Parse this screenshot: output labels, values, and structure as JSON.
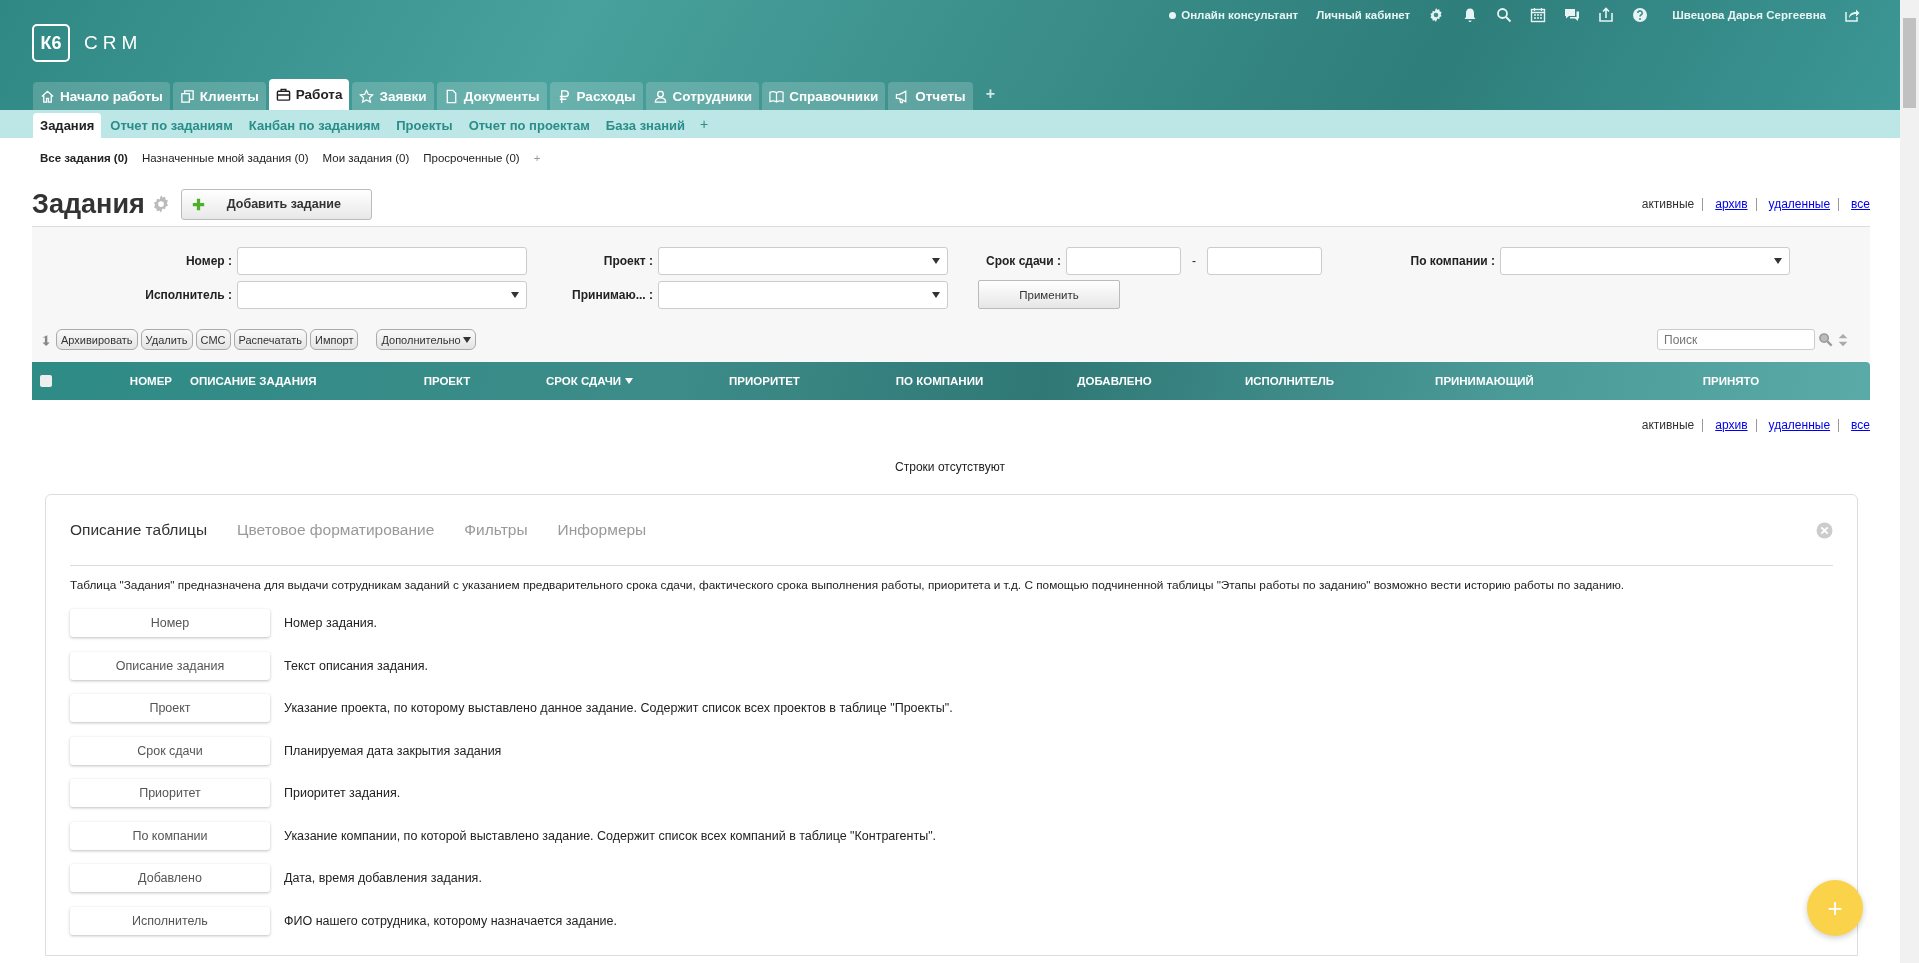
{
  "logo": {
    "mark": "К6",
    "text": "CRM"
  },
  "top_nav": {
    "online_consultant": "Онлайн консультант",
    "cabinet": "Личный кабинет",
    "user": "Швецова Дарья Сергеевна"
  },
  "main_tabs": [
    {
      "label": "Начало работы",
      "selected": false
    },
    {
      "label": "Клиенты",
      "selected": false
    },
    {
      "label": "Работа",
      "selected": true
    },
    {
      "label": "Заявки",
      "selected": false
    },
    {
      "label": "Документы",
      "selected": false
    },
    {
      "label": "Расходы",
      "selected": false
    },
    {
      "label": "Сотрудники",
      "selected": false
    },
    {
      "label": "Справочники",
      "selected": false
    },
    {
      "label": "Отчеты",
      "selected": false
    }
  ],
  "main_tabs_add": "+",
  "sub_tabs": [
    {
      "label": "Задания",
      "selected": true
    },
    {
      "label": "Отчет по заданиям",
      "selected": false
    },
    {
      "label": "Канбан по заданиям",
      "selected": false
    },
    {
      "label": "Проекты",
      "selected": false
    },
    {
      "label": "Отчет по проектам",
      "selected": false
    },
    {
      "label": "База знаний",
      "selected": false
    }
  ],
  "sub_tabs_add": "+",
  "filter_tabs": [
    {
      "label": "Все задания (0)",
      "selected": true
    },
    {
      "label": "Назначенные мной задания (0)",
      "selected": false
    },
    {
      "label": "Мои задания (0)",
      "selected": false
    },
    {
      "label": "Просроченные (0)",
      "selected": false
    }
  ],
  "filter_tabs_add": "+",
  "page_title": "Задания",
  "add_button": "Добавить задание",
  "view_links_top": [
    {
      "label": "активные",
      "selected": true
    },
    {
      "label": "архив",
      "selected": false
    },
    {
      "label": "удаленные",
      "selected": false
    },
    {
      "label": "все",
      "selected": false
    }
  ],
  "filters": [
    {
      "label": "Номер :",
      "kind": "text"
    },
    {
      "label": "Проект :",
      "kind": "select"
    },
    {
      "label": "Срок сдачи :",
      "kind": "range",
      "separator": "-"
    },
    {
      "label": "По компании :",
      "kind": "select"
    },
    {
      "label": "Исполнитель :",
      "kind": "select"
    },
    {
      "label": "Принимаю... :",
      "kind": "select"
    }
  ],
  "apply_button": "Применить",
  "actions": [
    "Архивировать",
    "Удалить",
    "СМС",
    "Распечатать",
    "Импорт"
  ],
  "more_button": "Дополнительно",
  "search": {
    "placeholder": "Поиск"
  },
  "table": {
    "columns": [
      {
        "label": "НОМЕР",
        "sorted": false
      },
      {
        "label": "ОПИСАНИЕ ЗАДАНИЯ",
        "sorted": false
      },
      {
        "label": "ПРОЕКТ",
        "sorted": false
      },
      {
        "label": "СРОК СДАЧИ",
        "sorted": true
      },
      {
        "label": "ПРИОРИТЕТ",
        "sorted": false
      },
      {
        "label": "ПО КОМПАНИИ",
        "sorted": false
      },
      {
        "label": "ДОБАВЛЕНО",
        "sorted": false
      },
      {
        "label": "ИСПОЛНИТЕЛЬ",
        "sorted": false
      },
      {
        "label": "ПРИНИМАЮЩИЙ",
        "sorted": false
      },
      {
        "label": "ПРИНЯТО",
        "sorted": false
      }
    ],
    "select_all_checked": false,
    "empty_text": "Строки отсутствуют"
  },
  "view_links_bottom": [
    {
      "label": "активные",
      "selected": true
    },
    {
      "label": "архив",
      "selected": false
    },
    {
      "label": "удаленные",
      "selected": false
    },
    {
      "label": "все",
      "selected": false
    }
  ],
  "info_card": {
    "tabs": [
      {
        "label": "Описание таблицы",
        "selected": true
      },
      {
        "label": "Цветовое форматирование",
        "selected": false
      },
      {
        "label": "Фильтры",
        "selected": false
      },
      {
        "label": "Информеры",
        "selected": false
      }
    ],
    "intro": "Таблица \"Задания\" предназначена для выдачи сотрудникам заданий с указанием предварительного срока сдачи, фактического срока выполнения работы, приоритета и т.д. С помощью подчиненной таблицы \"Этапы работы по заданию\" возможно вести историю работы по заданию.",
    "fields": [
      {
        "name": "Номер",
        "description": "Номер задания."
      },
      {
        "name": "Описание задания",
        "description": "Текст описания задания."
      },
      {
        "name": "Проект",
        "description": "Указание проекта, по которому выставлено данное задание. Содержит список всех проектов в таблице \"Проекты\"."
      },
      {
        "name": "Срок сдачи",
        "description": "Планируемая дата закрытия задания"
      },
      {
        "name": "Приоритет",
        "description": "Приоритет задания."
      },
      {
        "name": "По компании",
        "description": "Указание компании, по которой выставлено задание. Содержит список всех компаний в таблице \"Контрагенты\"."
      },
      {
        "name": "Добавлено",
        "description": "Дата, время добавления задания."
      },
      {
        "name": "Исполнитель",
        "description": "ФИО нашего сотрудника, которому назначается задание."
      }
    ]
  },
  "fab": "+"
}
